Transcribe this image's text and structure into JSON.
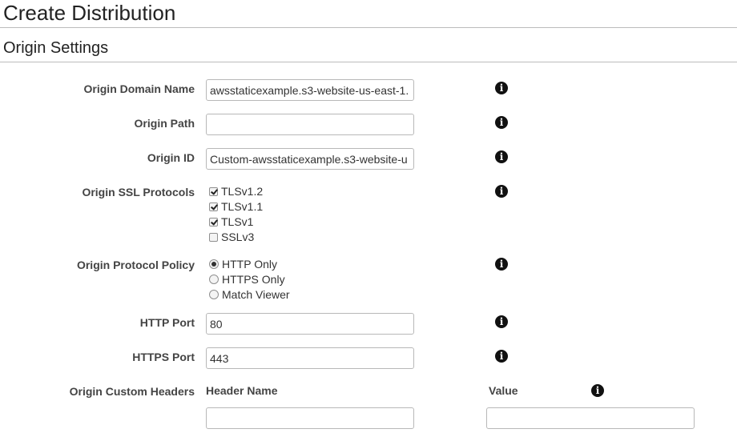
{
  "page_title": "Create Distribution",
  "section_title": "Origin Settings",
  "fields": {
    "origin_domain_name": {
      "label": "Origin Domain Name",
      "value": "awsstaticexample.s3-website-us-east-1."
    },
    "origin_path": {
      "label": "Origin Path",
      "value": ""
    },
    "origin_id": {
      "label": "Origin ID",
      "value": "Custom-awsstaticexample.s3-website-u"
    },
    "ssl_protocols": {
      "label": "Origin SSL Protocols",
      "options": [
        {
          "label": "TLSv1.2",
          "checked": true
        },
        {
          "label": "TLSv1.1",
          "checked": true
        },
        {
          "label": "TLSv1",
          "checked": true
        },
        {
          "label": "SSLv3",
          "checked": false
        }
      ]
    },
    "protocol_policy": {
      "label": "Origin Protocol Policy",
      "options": [
        {
          "label": "HTTP Only",
          "selected": true
        },
        {
          "label": "HTTPS Only",
          "selected": false
        },
        {
          "label": "Match Viewer",
          "selected": false
        }
      ]
    },
    "http_port": {
      "label": "HTTP Port",
      "value": "80"
    },
    "https_port": {
      "label": "HTTPS Port",
      "value": "443"
    },
    "custom_headers": {
      "label": "Origin Custom Headers",
      "header_name_label": "Header Name",
      "value_label": "Value",
      "header_name_value": "",
      "value_value": ""
    }
  },
  "icons": {
    "info": "info-circle-icon",
    "info_glyph": "i"
  }
}
